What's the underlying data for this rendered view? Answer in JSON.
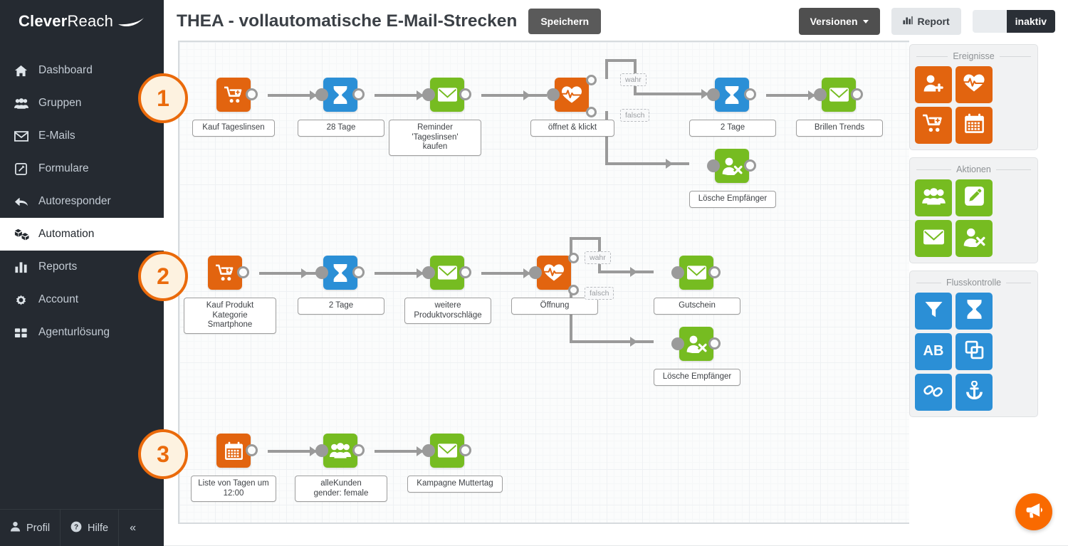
{
  "brand": {
    "name_bold": "Clever",
    "name_light": "Reach",
    "logo_icon": "swoosh-icon"
  },
  "sidebar": {
    "items": [
      {
        "label": "Dashboard",
        "icon": "home-icon",
        "active": false
      },
      {
        "label": "Gruppen",
        "icon": "users-icon",
        "active": false
      },
      {
        "label": "E-Mails",
        "icon": "envelope-icon",
        "active": false
      },
      {
        "label": "Formulare",
        "icon": "form-edit-icon",
        "active": false
      },
      {
        "label": "Autoresponder",
        "icon": "reply-all-icon",
        "active": false
      },
      {
        "label": "Automation",
        "icon": "blocks-icon",
        "active": true
      },
      {
        "label": "Reports",
        "icon": "bar-chart-icon",
        "active": false
      },
      {
        "label": "Account",
        "icon": "gear-icon",
        "active": false
      },
      {
        "label": "Agenturlösung",
        "icon": "grid-squares-icon",
        "active": false
      }
    ],
    "bottom": {
      "profile_label": "Profil",
      "profile_icon": "user-icon",
      "help_label": "Hilfe",
      "help_icon": "question-circle-icon",
      "collapse_icon": "chevron-double-left-icon"
    }
  },
  "header": {
    "title": "THEA - vollautomatische E-Mail-Strecken",
    "save_label": "Speichern",
    "versions_label": "Versionen",
    "versions_icon": "caret-down-icon",
    "report_label": "Report",
    "report_icon": "bar-chart-icon",
    "status_toggle": {
      "state_label": "inaktiv",
      "active": false
    }
  },
  "canvas": {
    "badges": [
      "1",
      "2",
      "3"
    ],
    "branch_labels": {
      "true": "wahr",
      "false": "falsch"
    },
    "rows": [
      {
        "badge": "1",
        "nodes": [
          {
            "label": "Kauf Tageslinsen",
            "icon": "cart-add-icon",
            "color": "orange"
          },
          {
            "label": "28 Tage",
            "icon": "hourglass-icon",
            "color": "blue"
          },
          {
            "label": "Reminder 'Tageslinsen'\nkaufen",
            "icon": "envelope-icon",
            "color": "green"
          },
          {
            "label": "öffnet & klickt",
            "icon": "heart-pulse-icon",
            "color": "orange"
          },
          {
            "label": "2 Tage",
            "icon": "hourglass-icon",
            "color": "blue"
          },
          {
            "label": "Brillen Trends",
            "icon": "envelope-icon",
            "color": "green"
          },
          {
            "label": "Lösche Empfänger",
            "icon": "user-remove-icon",
            "color": "green"
          }
        ]
      },
      {
        "badge": "2",
        "nodes": [
          {
            "label": "Kauf Produkt Kategorie\nSmartphone",
            "icon": "cart-add-icon",
            "color": "orange"
          },
          {
            "label": "2 Tage",
            "icon": "hourglass-icon",
            "color": "blue"
          },
          {
            "label": "weitere\nProduktvorschläge",
            "icon": "envelope-icon",
            "color": "green"
          },
          {
            "label": "Öffnung",
            "icon": "heart-pulse-icon",
            "color": "orange"
          },
          {
            "label": "Gutschein",
            "icon": "envelope-icon",
            "color": "green"
          },
          {
            "label": "Lösche Empfänger",
            "icon": "user-remove-icon",
            "color": "green"
          }
        ]
      },
      {
        "badge": "3",
        "nodes": [
          {
            "label": "Liste von Tagen um\n12:00",
            "icon": "calendar-icon",
            "color": "orange"
          },
          {
            "label": "alleKunden\ngender: female",
            "icon": "users-icon",
            "color": "green"
          },
          {
            "label": "Kampagne Muttertag",
            "icon": "envelope-icon",
            "color": "green"
          }
        ]
      }
    ]
  },
  "palette": {
    "groups": [
      {
        "title": "Ereignisse",
        "color": "orange",
        "tiles": [
          {
            "icon": "user-add-icon"
          },
          {
            "icon": "heart-pulse-icon"
          },
          {
            "icon": "cart-add-icon"
          },
          {
            "icon": "calendar-icon"
          }
        ]
      },
      {
        "title": "Aktionen",
        "color": "green",
        "tiles": [
          {
            "icon": "users-icon"
          },
          {
            "icon": "pencil-square-icon"
          },
          {
            "icon": "envelope-icon"
          },
          {
            "icon": "user-remove-icon"
          }
        ]
      },
      {
        "title": "Flusskontrolle",
        "color": "blue",
        "tiles": [
          {
            "icon": "filter-icon"
          },
          {
            "icon": "hourglass-icon"
          },
          {
            "icon": "ab-test-icon"
          },
          {
            "icon": "copy-icon"
          },
          {
            "icon": "link-icon"
          },
          {
            "icon": "anchor-icon"
          }
        ]
      }
    ]
  },
  "fab": {
    "icon": "megaphone-icon"
  },
  "colors": {
    "orange": "#e2640f",
    "green": "#76bc21",
    "blue": "#2b8fd6",
    "sidebar_bg": "#252a31",
    "badge_accent": "#ea6a0b",
    "edge": "#9a9a9a"
  }
}
